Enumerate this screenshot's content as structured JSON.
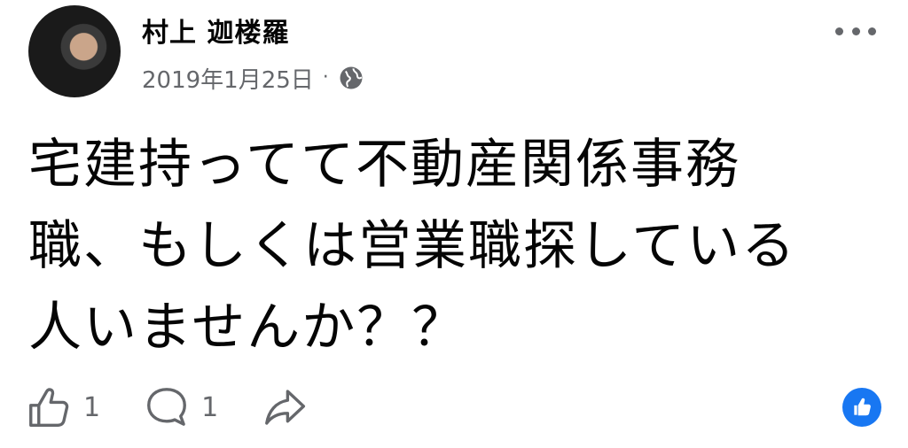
{
  "post": {
    "author": "村上 迦楼羅",
    "date": "2019年1月25日",
    "separator": "·",
    "privacy_icon": "globe-icon",
    "text": "宅建持ってて不動産関係事務職、もしくは営業職探している人いませんか？？"
  },
  "reactions": {
    "like_count": "1",
    "comment_count": "1",
    "like_icon": "thumbs-up-icon",
    "comment_icon": "comment-bubble-icon",
    "share_icon": "share-arrow-icon",
    "reaction_badge_icon": "like-reaction-icon"
  },
  "colors": {
    "text": "#050505",
    "secondary": "#65676b",
    "brand": "#1877f2"
  }
}
